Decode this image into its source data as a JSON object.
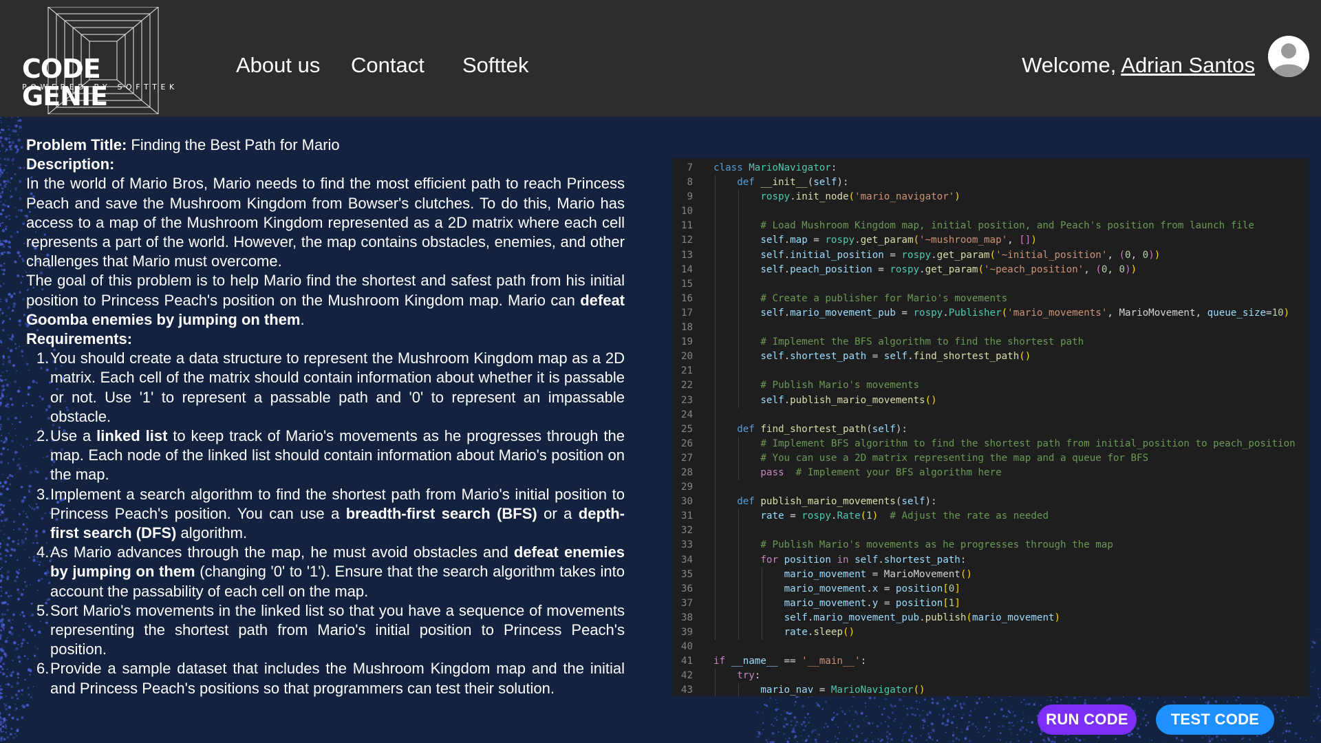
{
  "header": {
    "logo_title": "CODE GENIE",
    "logo_tagline": "POWERED BY SOFTTEK",
    "nav": [
      "About us",
      "Contact",
      "Softtek"
    ],
    "welcome_prefix": "Welcome, ",
    "user_name": "Adrian Santos"
  },
  "problem": {
    "title_label": "Problem Title:",
    "title": " Finding the Best Path for Mario",
    "description_label": "Description:",
    "description_1": "In the world of Mario Bros, Mario needs to find the most efficient path to reach Princess Peach and save the Mushroom Kingdom from Bowser's clutches. To do this, Mario has access to a map of the Mushroom Kingdom represented as a 2D matrix where each cell represents a part of the world. However, the map contains obstacles, enemies, and other challenges that Mario must overcome.",
    "description_2a": "The goal of this problem is to help Mario find the shortest and safest path from his initial position to Princess Peach's position on the Mushroom Kingdom map. Mario can ",
    "description_2b": "defeat Goomba enemies by jumping on them",
    "description_2c": ".",
    "requirements_label": "Requirements:",
    "requirements": [
      {
        "num": "1.",
        "parts": [
          {
            "t": "You should create a data structure to represent the Mushroom Kingdom map as a 2D matrix. Each cell of the matrix should contain information about whether it is passable or not. Use '1' to represent a passable path and '0' to represent an impassable obstacle.",
            "b": false
          }
        ]
      },
      {
        "num": "2.",
        "parts": [
          {
            "t": "Use a ",
            "b": false
          },
          {
            "t": "linked list",
            "b": true
          },
          {
            "t": " to keep track of Mario's movements as he progresses through the map. Each node of the linked list should contain information about Mario's position on the map.",
            "b": false
          }
        ]
      },
      {
        "num": "3.",
        "parts": [
          {
            "t": "Implement a search algorithm to find the shortest path from Mario's initial position to Princess Peach's position. You can use a ",
            "b": false
          },
          {
            "t": "breadth-first search (BFS)",
            "b": true
          },
          {
            "t": " or a ",
            "b": false
          },
          {
            "t": "depth-first search (DFS)",
            "b": true
          },
          {
            "t": " algorithm.",
            "b": false
          }
        ]
      },
      {
        "num": "4.",
        "parts": [
          {
            "t": "As Mario advances through the map, he must avoid obstacles and ",
            "b": false
          },
          {
            "t": "defeat enemies by jumping on them",
            "b": true
          },
          {
            "t": " (changing '0' to '1'). Ensure that the search algorithm takes into account the passability of each cell on the map.",
            "b": false
          }
        ]
      },
      {
        "num": "5.",
        "parts": [
          {
            "t": "Sort Mario's movements in the linked list so that you have a sequence of movements representing the shortest path from Mario's initial position to Princess Peach's position.",
            "b": false
          }
        ]
      },
      {
        "num": "6.",
        "parts": [
          {
            "t": "Provide a sample dataset that includes the Mushroom Kingdom map and the initial and Princess Peach's positions so that programmers can test their solution.",
            "b": false
          }
        ]
      }
    ]
  },
  "code": {
    "lines": [
      {
        "n": 7,
        "i": 0,
        "t": [
          [
            "kw",
            "class "
          ],
          [
            "cls",
            "MarioNavigator"
          ],
          [
            "p",
            ":"
          ]
        ]
      },
      {
        "n": 8,
        "i": 1,
        "t": [
          [
            "kw",
            "def "
          ],
          [
            "fn",
            "__init__"
          ],
          [
            "p",
            "("
          ],
          [
            "vr",
            "self"
          ],
          [
            "p",
            "):"
          ]
        ]
      },
      {
        "n": 9,
        "i": 2,
        "t": [
          [
            "cls",
            "rospy"
          ],
          [
            "p",
            "."
          ],
          [
            "fn",
            "init_node"
          ],
          [
            "bl",
            "("
          ],
          [
            "st",
            "'mario_navigator'"
          ],
          [
            "bl",
            ")"
          ]
        ]
      },
      {
        "n": 10,
        "i": 2,
        "t": []
      },
      {
        "n": 11,
        "i": 2,
        "t": [
          [
            "cm",
            "# Load Mushroom Kingdom map, initial position, and Peach's position from launch file"
          ]
        ]
      },
      {
        "n": 12,
        "i": 2,
        "t": [
          [
            "vr",
            "self"
          ],
          [
            "p",
            "."
          ],
          [
            "vr",
            "map"
          ],
          [
            "p",
            " = "
          ],
          [
            "cls",
            "rospy"
          ],
          [
            "p",
            "."
          ],
          [
            "fn",
            "get_param"
          ],
          [
            "bl",
            "("
          ],
          [
            "st",
            "'~mushroom_map'"
          ],
          [
            "p",
            ", "
          ],
          [
            "pl",
            "[]"
          ],
          [
            "bl",
            ")"
          ]
        ]
      },
      {
        "n": 13,
        "i": 2,
        "t": [
          [
            "vr",
            "self"
          ],
          [
            "p",
            "."
          ],
          [
            "vr",
            "initial_position"
          ],
          [
            "p",
            " = "
          ],
          [
            "cls",
            "rospy"
          ],
          [
            "p",
            "."
          ],
          [
            "fn",
            "get_param"
          ],
          [
            "bl",
            "("
          ],
          [
            "st",
            "'~initial_position'"
          ],
          [
            "p",
            ", "
          ],
          [
            "pl",
            "("
          ],
          [
            "nm",
            "0"
          ],
          [
            "p",
            ", "
          ],
          [
            "nm",
            "0"
          ],
          [
            "pl",
            ")"
          ],
          [
            "bl",
            ")"
          ]
        ]
      },
      {
        "n": 14,
        "i": 2,
        "t": [
          [
            "vr",
            "self"
          ],
          [
            "p",
            "."
          ],
          [
            "vr",
            "peach_position"
          ],
          [
            "p",
            " = "
          ],
          [
            "cls",
            "rospy"
          ],
          [
            "p",
            "."
          ],
          [
            "fn",
            "get_param"
          ],
          [
            "bl",
            "("
          ],
          [
            "st",
            "'~peach_position'"
          ],
          [
            "p",
            ", "
          ],
          [
            "pl",
            "("
          ],
          [
            "nm",
            "0"
          ],
          [
            "p",
            ", "
          ],
          [
            "nm",
            "0"
          ],
          [
            "pl",
            ")"
          ],
          [
            "bl",
            ")"
          ]
        ]
      },
      {
        "n": 15,
        "i": 2,
        "t": []
      },
      {
        "n": 16,
        "i": 2,
        "t": [
          [
            "cm",
            "# Create a publisher for Mario's movements"
          ]
        ]
      },
      {
        "n": 17,
        "i": 2,
        "t": [
          [
            "vr",
            "self"
          ],
          [
            "p",
            "."
          ],
          [
            "vr",
            "mario_movement_pub"
          ],
          [
            "p",
            " = "
          ],
          [
            "cls",
            "rospy"
          ],
          [
            "p",
            "."
          ],
          [
            "cls",
            "Publisher"
          ],
          [
            "bl",
            "("
          ],
          [
            "st",
            "'mario_movements'"
          ],
          [
            "p",
            ", MarioMovement, "
          ],
          [
            "vr",
            "queue_size"
          ],
          [
            "p",
            "="
          ],
          [
            "nm",
            "10"
          ],
          [
            "bl",
            ")"
          ]
        ]
      },
      {
        "n": 18,
        "i": 2,
        "t": []
      },
      {
        "n": 19,
        "i": 2,
        "t": [
          [
            "cm",
            "# Implement the BFS algorithm to find the shortest path"
          ]
        ]
      },
      {
        "n": 20,
        "i": 2,
        "t": [
          [
            "vr",
            "self"
          ],
          [
            "p",
            "."
          ],
          [
            "vr",
            "shortest_path"
          ],
          [
            "p",
            " = "
          ],
          [
            "vr",
            "self"
          ],
          [
            "p",
            "."
          ],
          [
            "fn",
            "find_shortest_path"
          ],
          [
            "bl",
            "()"
          ]
        ]
      },
      {
        "n": 21,
        "i": 2,
        "t": []
      },
      {
        "n": 22,
        "i": 2,
        "t": [
          [
            "cm",
            "# Publish Mario's movements"
          ]
        ]
      },
      {
        "n": 23,
        "i": 2,
        "t": [
          [
            "vr",
            "self"
          ],
          [
            "p",
            "."
          ],
          [
            "fn",
            "publish_mario_movements"
          ],
          [
            "bl",
            "()"
          ]
        ]
      },
      {
        "n": 24,
        "i": 1,
        "t": []
      },
      {
        "n": 25,
        "i": 1,
        "t": [
          [
            "kw",
            "def "
          ],
          [
            "fn",
            "find_shortest_path"
          ],
          [
            "p",
            "("
          ],
          [
            "vr",
            "self"
          ],
          [
            "p",
            "):"
          ]
        ]
      },
      {
        "n": 26,
        "i": 2,
        "t": [
          [
            "cm",
            "# Implement BFS algorithm to find the shortest path from initial_position to peach_position"
          ]
        ]
      },
      {
        "n": 27,
        "i": 2,
        "t": [
          [
            "cm",
            "# You can use a 2D matrix representing the map and a queue for BFS"
          ]
        ]
      },
      {
        "n": 28,
        "i": 2,
        "t": [
          [
            "kc",
            "pass"
          ],
          [
            "p",
            "  "
          ],
          [
            "cm",
            "# Implement your BFS algorithm here"
          ]
        ]
      },
      {
        "n": 29,
        "i": 1,
        "t": []
      },
      {
        "n": 30,
        "i": 1,
        "t": [
          [
            "kw",
            "def "
          ],
          [
            "fn",
            "publish_mario_movements"
          ],
          [
            "p",
            "("
          ],
          [
            "vr",
            "self"
          ],
          [
            "p",
            "):"
          ]
        ]
      },
      {
        "n": 31,
        "i": 2,
        "t": [
          [
            "vr",
            "rate"
          ],
          [
            "p",
            " = "
          ],
          [
            "cls",
            "rospy"
          ],
          [
            "p",
            "."
          ],
          [
            "cls",
            "Rate"
          ],
          [
            "bl",
            "("
          ],
          [
            "nm",
            "1"
          ],
          [
            "bl",
            ")"
          ],
          [
            "p",
            "  "
          ],
          [
            "cm",
            "# Adjust the rate as needed"
          ]
        ]
      },
      {
        "n": 32,
        "i": 2,
        "t": []
      },
      {
        "n": 33,
        "i": 2,
        "t": [
          [
            "cm",
            "# Publish Mario's movements as he progresses through the map"
          ]
        ]
      },
      {
        "n": 34,
        "i": 2,
        "t": [
          [
            "kc",
            "for "
          ],
          [
            "vr",
            "position"
          ],
          [
            "kc",
            " in "
          ],
          [
            "vr",
            "self"
          ],
          [
            "p",
            "."
          ],
          [
            "vr",
            "shortest_path"
          ],
          [
            "p",
            ":"
          ]
        ]
      },
      {
        "n": 35,
        "i": 3,
        "t": [
          [
            "vr",
            "mario_movement"
          ],
          [
            "p",
            " = MarioMovement"
          ],
          [
            "bl",
            "()"
          ]
        ]
      },
      {
        "n": 36,
        "i": 3,
        "t": [
          [
            "vr",
            "mario_movement"
          ],
          [
            "p",
            "."
          ],
          [
            "vr",
            "x"
          ],
          [
            "p",
            " = "
          ],
          [
            "vr",
            "position"
          ],
          [
            "bl",
            "["
          ],
          [
            "nm",
            "0"
          ],
          [
            "bl",
            "]"
          ]
        ]
      },
      {
        "n": 37,
        "i": 3,
        "t": [
          [
            "vr",
            "mario_movement"
          ],
          [
            "p",
            "."
          ],
          [
            "vr",
            "y"
          ],
          [
            "p",
            " = "
          ],
          [
            "vr",
            "position"
          ],
          [
            "bl",
            "["
          ],
          [
            "nm",
            "1"
          ],
          [
            "bl",
            "]"
          ]
        ]
      },
      {
        "n": 38,
        "i": 3,
        "t": [
          [
            "vr",
            "self"
          ],
          [
            "p",
            "."
          ],
          [
            "vr",
            "mario_movement_pub"
          ],
          [
            "p",
            "."
          ],
          [
            "fn",
            "publish"
          ],
          [
            "bl",
            "("
          ],
          [
            "vr",
            "mario_movement"
          ],
          [
            "bl",
            ")"
          ]
        ]
      },
      {
        "n": 39,
        "i": 3,
        "t": [
          [
            "vr",
            "rate"
          ],
          [
            "p",
            "."
          ],
          [
            "fn",
            "sleep"
          ],
          [
            "bl",
            "()"
          ]
        ]
      },
      {
        "n": 40,
        "i": 0,
        "t": []
      },
      {
        "n": 41,
        "i": 0,
        "t": [
          [
            "kc",
            "if "
          ],
          [
            "vr",
            "__name__"
          ],
          [
            "p",
            " == "
          ],
          [
            "st",
            "'__main__'"
          ],
          [
            "p",
            ":"
          ]
        ]
      },
      {
        "n": 42,
        "i": 1,
        "t": [
          [
            "kc",
            "try"
          ],
          [
            "p",
            ":"
          ]
        ]
      },
      {
        "n": 43,
        "i": 2,
        "t": [
          [
            "vr",
            "mario_nav"
          ],
          [
            "p",
            " = "
          ],
          [
            "cls",
            "MarioNavigator"
          ],
          [
            "bl",
            "()"
          ]
        ]
      }
    ]
  },
  "buttons": {
    "run": "RUN CODE",
    "test": "TEST CODE"
  },
  "colors": {
    "header_bg": "#2d2d2d",
    "page_bg": "#12223f",
    "code_bg": "#1e1e1e",
    "run_button": "#7b2ff7",
    "test_button": "#1e90ff",
    "dots": "#4a5fd8"
  },
  "icons": {
    "avatar": "user-avatar-icon"
  }
}
